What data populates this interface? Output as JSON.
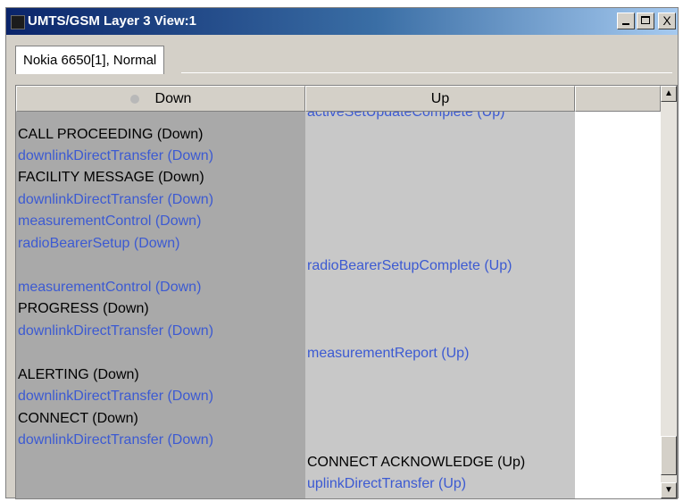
{
  "window": {
    "title": "UMTS/GSM Layer 3 View:1"
  },
  "controls": {
    "minimize": "_",
    "maximize": "□",
    "close": "X"
  },
  "tab": {
    "label": "Nokia 6650[1], Normal"
  },
  "columns": {
    "down": "Down",
    "up": "Up",
    "extra": ""
  },
  "messages": {
    "up_0": "activeSetUpdateComplete (Up)",
    "down_0": "CALL PROCEEDING (Down)",
    "down_1": "downlinkDirectTransfer (Down)",
    "down_2": "FACILITY MESSAGE (Down)",
    "down_3": "downlinkDirectTransfer (Down)",
    "down_4": "measurementControl (Down)",
    "down_5": "radioBearerSetup (Down)",
    "up_1": "radioBearerSetupComplete (Up)",
    "down_6": "measurementControl (Down)",
    "down_7": "PROGRESS (Down)",
    "down_8": "downlinkDirectTransfer (Down)",
    "up_2": "measurementReport (Up)",
    "down_9": "ALERTING (Down)",
    "down_10": "downlinkDirectTransfer (Down)",
    "down_11": "CONNECT (Down)",
    "down_12": "downlinkDirectTransfer (Down)",
    "up_3": "CONNECT ACKNOWLEDGE (Up)",
    "up_4": "uplinkDirectTransfer (Up)"
  },
  "scrollbar": {
    "up_arrow": "▲",
    "down_arrow": "▼"
  },
  "colors": {
    "title_gradient_start": "#0a246a",
    "title_gradient_end": "#a6caf0",
    "down_column_bg": "#a9a9a9",
    "up_column_bg": "#c8c8c8",
    "signaling_text": "#000000",
    "rrc_text": "#3c5ad2"
  }
}
